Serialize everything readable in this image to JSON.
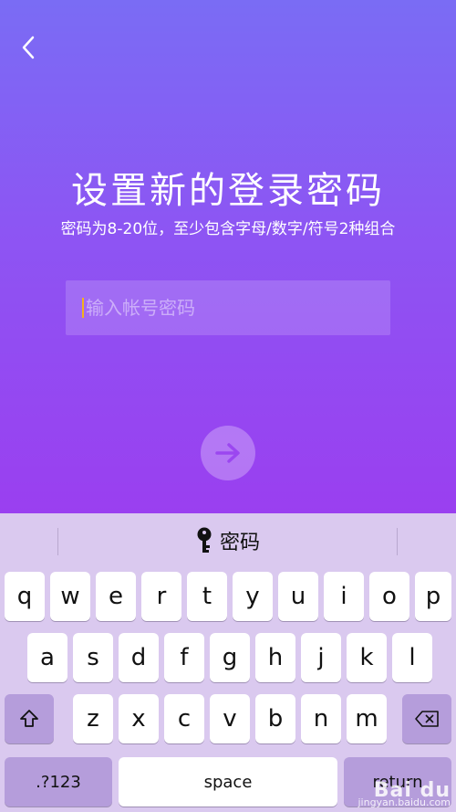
{
  "header": {
    "back_icon": "chevron-left-icon"
  },
  "main": {
    "title": "设置新的登录密码",
    "subtitle": "密码为8-20位，至少包含字母/数字/符号2种组合",
    "password_placeholder": "输入帐号密码",
    "next_icon": "arrow-right-icon"
  },
  "keyboard": {
    "suggestion": {
      "icon": "key-icon",
      "label": "密码"
    },
    "row1": [
      "q",
      "w",
      "e",
      "r",
      "t",
      "y",
      "u",
      "i",
      "o",
      "p"
    ],
    "row2": [
      "a",
      "s",
      "d",
      "f",
      "g",
      "h",
      "j",
      "k",
      "l"
    ],
    "row3": [
      "z",
      "x",
      "c",
      "v",
      "b",
      "n",
      "m"
    ],
    "shift_icon": "shift-icon",
    "delete_icon": "backspace-icon",
    "numbers_label": ".?123",
    "space_label": "space",
    "return_label": "return"
  },
  "colors": {
    "gradient_top": "#7a6cf4",
    "gradient_bottom": "#9a3ff0",
    "caret": "#f3b11b",
    "keyboard_bg": "#dac9ef"
  }
}
